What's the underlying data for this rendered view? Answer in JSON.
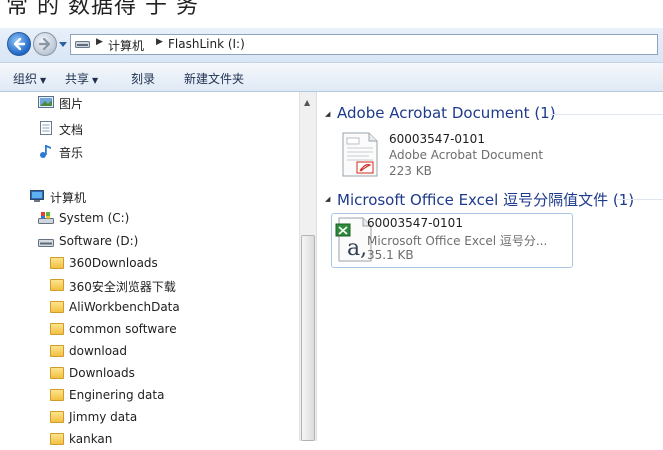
{
  "top_strip_text": "常 的 数据得 于 务",
  "address": {
    "crumbs": [
      "计算机",
      "FlashLink (I:)"
    ]
  },
  "toolbar": {
    "organize": "组织",
    "share": "共享",
    "burn": "刻录",
    "new_folder": "新建文件夹"
  },
  "nav": {
    "libraries": [
      {
        "label": "图片",
        "icon": "pictures-icon"
      },
      {
        "label": "文档",
        "icon": "documents-icon"
      },
      {
        "label": "音乐",
        "icon": "music-icon"
      }
    ],
    "computer": "计算机",
    "drives": [
      {
        "label": "System (C:)",
        "icon": "system-drive-icon"
      },
      {
        "label": "Software  (D:)",
        "icon": "drive-icon"
      }
    ],
    "folders": [
      "360Downloads",
      "360安全浏览器下载",
      "AliWorkbenchData",
      "common software",
      "download",
      "Downloads",
      "Enginering data",
      "Jimmy data",
      "kankan"
    ]
  },
  "groups": [
    {
      "title": "Adobe Acrobat Document (1)",
      "file": {
        "name": "60003547-0101",
        "type": "Adobe Acrobat Document",
        "size": "223 KB",
        "icon": "pdf-file-icon"
      }
    },
    {
      "title": "Microsoft Office Excel 逗号分隔值文件 (1)",
      "file": {
        "name": "60003547-0101",
        "type": "Microsoft Office Excel 逗号分...",
        "size": "35.1 KB",
        "icon": "csv-file-icon"
      }
    }
  ],
  "colors": {
    "accent": "#1e3a8c",
    "selection_border": "#a9c6e4"
  }
}
